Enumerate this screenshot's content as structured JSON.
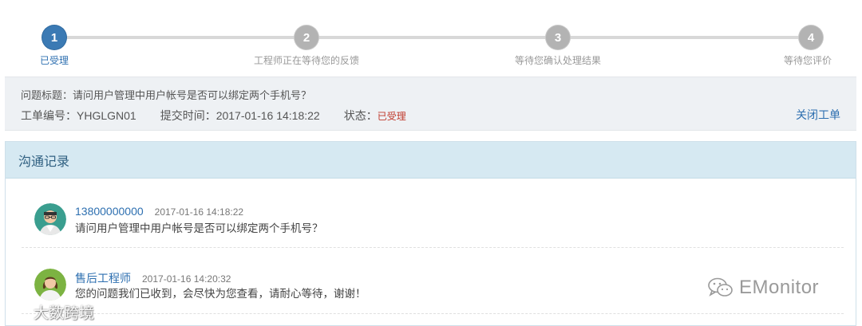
{
  "stepper": {
    "steps": [
      {
        "number": "1",
        "label": "已受理",
        "active": true
      },
      {
        "number": "2",
        "label": "工程师正在等待您的反馈",
        "active": false
      },
      {
        "number": "3",
        "label": "等待您确认处理结果",
        "active": false
      },
      {
        "number": "4",
        "label": "等待您评价",
        "active": false
      }
    ]
  },
  "ticket": {
    "title_label": "问题标题：",
    "title": "请问用户管理中用户帐号是否可以绑定两个手机号？",
    "number_label": "工单编号：",
    "number": "YHGLGN01",
    "submit_label": "提交时间：",
    "submit_time": "2017-01-16 14:18:22",
    "status_label": "状态：",
    "status": "已受理",
    "close_label": "关闭工单"
  },
  "comm": {
    "header": "沟通记录",
    "messages": [
      {
        "name": "13800000000",
        "time": "2017-01-16 14:18:22",
        "text": "请问用户管理中用户帐号是否可以绑定两个手机号？"
      },
      {
        "name": "售后工程师",
        "time": "2017-01-16 14:20:32",
        "text": "您的问题我们已收到，会尽快为您查看，请耐心等待，谢谢！"
      }
    ]
  },
  "watermarks": {
    "left": "大数跨境",
    "right": "EMonitor"
  },
  "colors": {
    "accent": "#3b7ab4",
    "status": "#c0392b",
    "header_bg": "#d6e9f2"
  }
}
